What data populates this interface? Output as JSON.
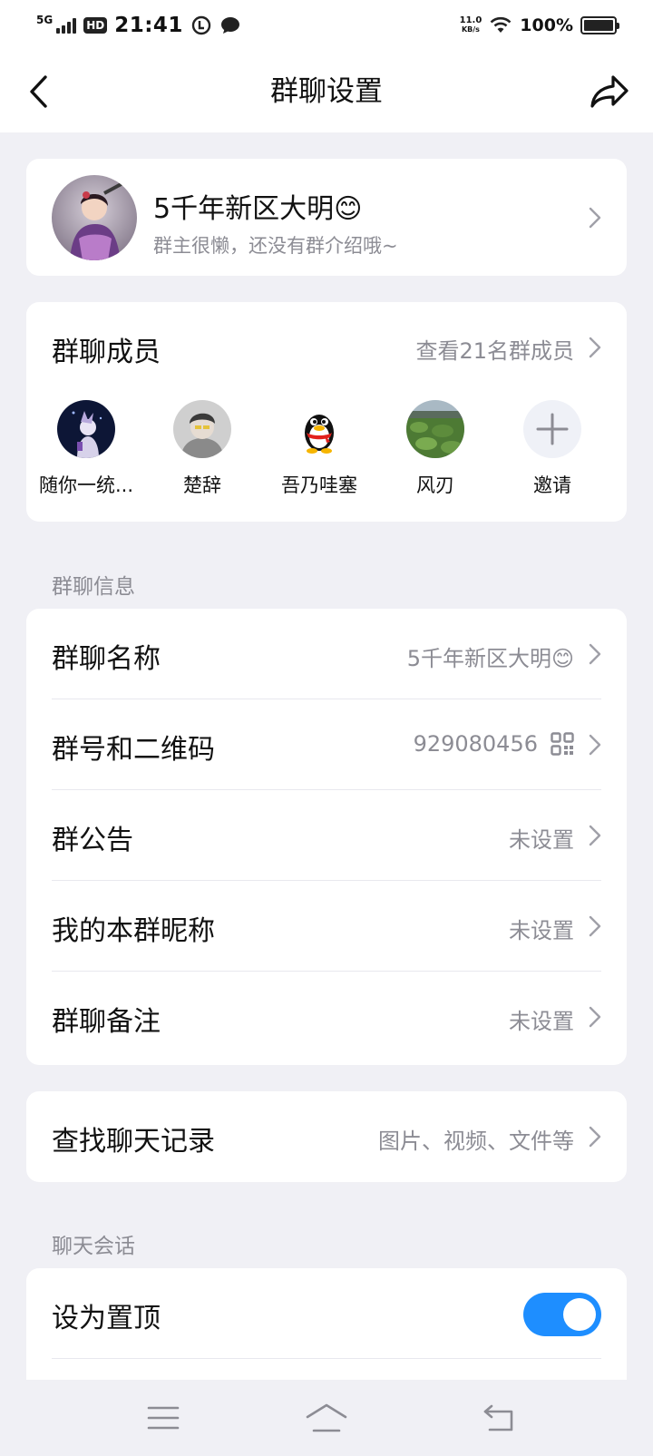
{
  "status_bar": {
    "network": "5G",
    "hd": "HD",
    "time": "21:41",
    "speed_value": "11.0",
    "speed_unit": "KB/s",
    "battery_text": "100%",
    "battery_level": 1.0
  },
  "nav": {
    "title": "群聊设置"
  },
  "group": {
    "name": "5千年新区大明😊",
    "description": "群主很懒，还没有群介绍哦~"
  },
  "members": {
    "title": "群聊成员",
    "view_all": "查看21名群成员",
    "list": [
      {
        "name": "随你一统..."
      },
      {
        "name": "楚辞"
      },
      {
        "name": "吾乃哇塞"
      },
      {
        "name": "风刃"
      }
    ],
    "invite_label": "邀请"
  },
  "sections": {
    "group_info": "群聊信息",
    "chat_session": "聊天会话"
  },
  "info_rows": [
    {
      "label": "群聊名称",
      "value": "5千年新区大明😊"
    },
    {
      "label": "群号和二维码",
      "value": "929080456"
    },
    {
      "label": "群公告",
      "value": "未设置"
    },
    {
      "label": "我的本群昵称",
      "value": "未设置"
    },
    {
      "label": "群聊备注",
      "value": "未设置"
    }
  ],
  "search_history": {
    "label": "查找聊天记录",
    "value": "图片、视频、文件等"
  },
  "pin": {
    "label": "设为置顶",
    "enabled": true
  },
  "colors": {
    "accent": "#1e8eff",
    "background": "#f0f0f5",
    "secondary_text": "#8c8c94"
  },
  "icons": {
    "back": "chevron-left-icon",
    "share": "share-arrow-icon",
    "qr": "qr-code-icon",
    "menu": "menu-icon",
    "home": "home-icon",
    "return": "return-icon"
  }
}
